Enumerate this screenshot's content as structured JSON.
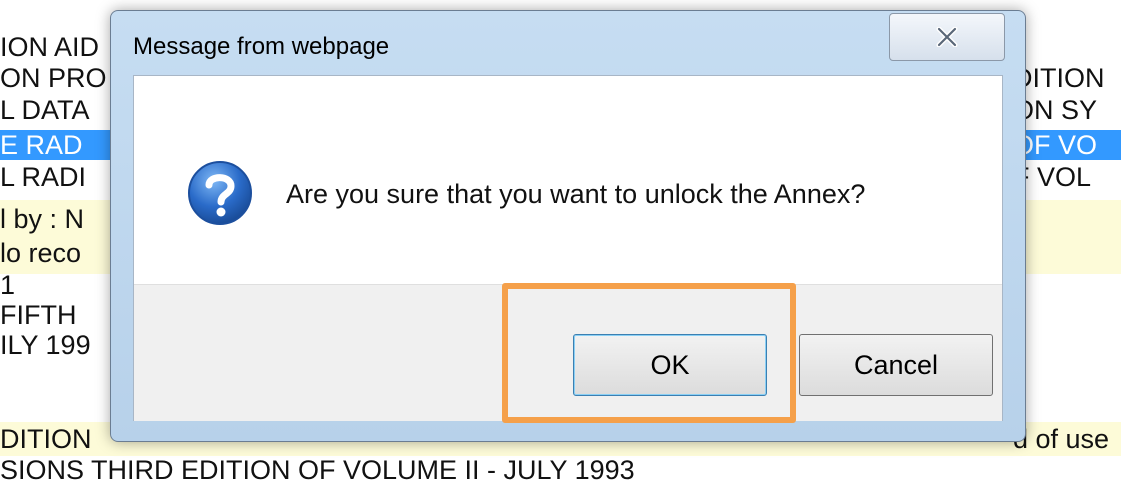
{
  "background_page": {
    "left_fragments": [
      "ION AID",
      "ON PRO",
      "L DATA",
      "E RAD",
      "L RADI",
      "l by : N",
      "lo reco",
      "1",
      "FIFTH",
      "ILY 199",
      "DITION"
    ],
    "right_fragments": [
      "DITION",
      "ON SY",
      "OF VO",
      "F VOL",
      "d of use"
    ],
    "bottom_line": "SIONS THIRD EDITION OF VOLUME II - JULY 1993"
  },
  "dialog": {
    "title": "Message from webpage",
    "close_icon": "close-x-icon",
    "icon": "question-icon",
    "message": "Are you sure that you want to unlock the Annex?",
    "ok_label": "OK",
    "cancel_label": "Cancel"
  },
  "colors": {
    "highlight_annotation": "#f5a04a",
    "selection_blue": "#3399ff",
    "row_yellow": "#fdfbd8",
    "dialog_frame": "#c6ddf2",
    "icon_blue": "#2a6bc9"
  }
}
